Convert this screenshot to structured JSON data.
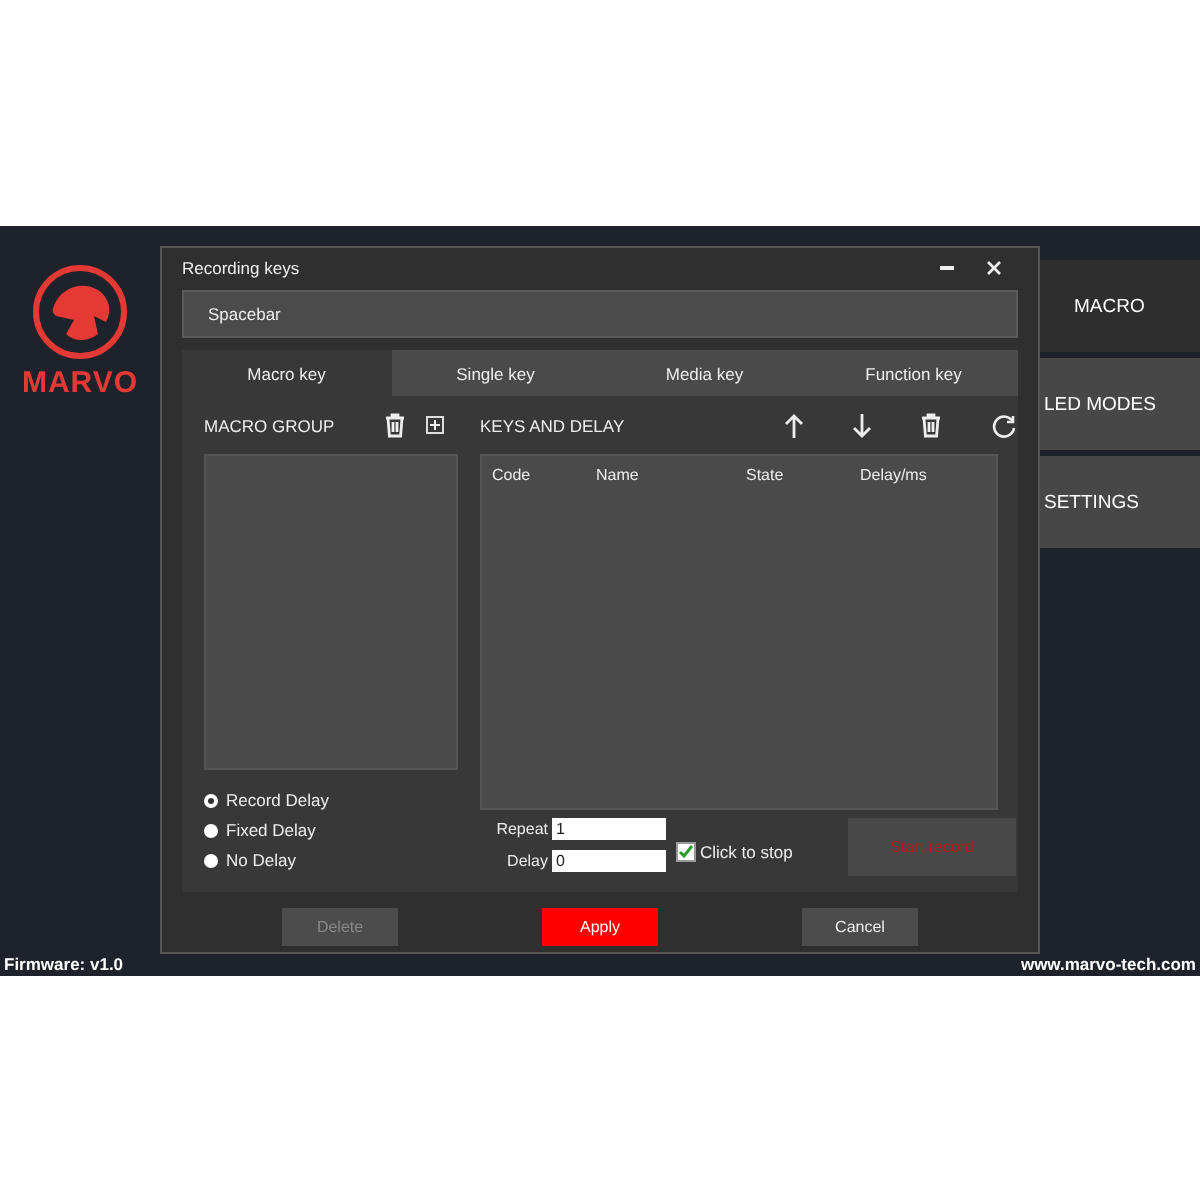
{
  "app": {
    "logo_text": "MARVO",
    "firmware": "Firmware: v1.0",
    "website": "www.marvo-tech.com"
  },
  "menu": [
    {
      "label": "MACRO",
      "selected": true
    },
    {
      "label": "LED MODES",
      "selected": false
    },
    {
      "label": "SETTINGS",
      "selected": false
    }
  ],
  "dialog": {
    "title": "Recording keys",
    "key_field": "Spacebar",
    "tabs": [
      {
        "label": "Macro key",
        "selected": true
      },
      {
        "label": "Single key",
        "selected": false
      },
      {
        "label": "Media key",
        "selected": false
      },
      {
        "label": "Function key",
        "selected": false
      }
    ],
    "macro_group": {
      "title": "MACRO GROUP",
      "delay_options": [
        {
          "label": "Record Delay",
          "selected": true
        },
        {
          "label": "Fixed Delay",
          "selected": false
        },
        {
          "label": "No Delay",
          "selected": false
        }
      ]
    },
    "keys_and_delay": {
      "title": "KEYS AND DELAY",
      "columns": [
        "Code",
        "Name",
        "State",
        "Delay/ms"
      ]
    },
    "repeat": {
      "label": "Repeat",
      "value": "1"
    },
    "delay": {
      "label": "Delay",
      "value": "0"
    },
    "click_to_stop": {
      "label": "Click to stop",
      "checked": true
    },
    "start_record": {
      "label": "Start record",
      "disabled": true
    },
    "buttons": [
      {
        "label": "Delete",
        "kind": "plain",
        "disabled": true
      },
      {
        "label": "Apply",
        "kind": "primary",
        "disabled": false
      },
      {
        "label": "Cancel",
        "kind": "plain",
        "disabled": false
      }
    ]
  }
}
